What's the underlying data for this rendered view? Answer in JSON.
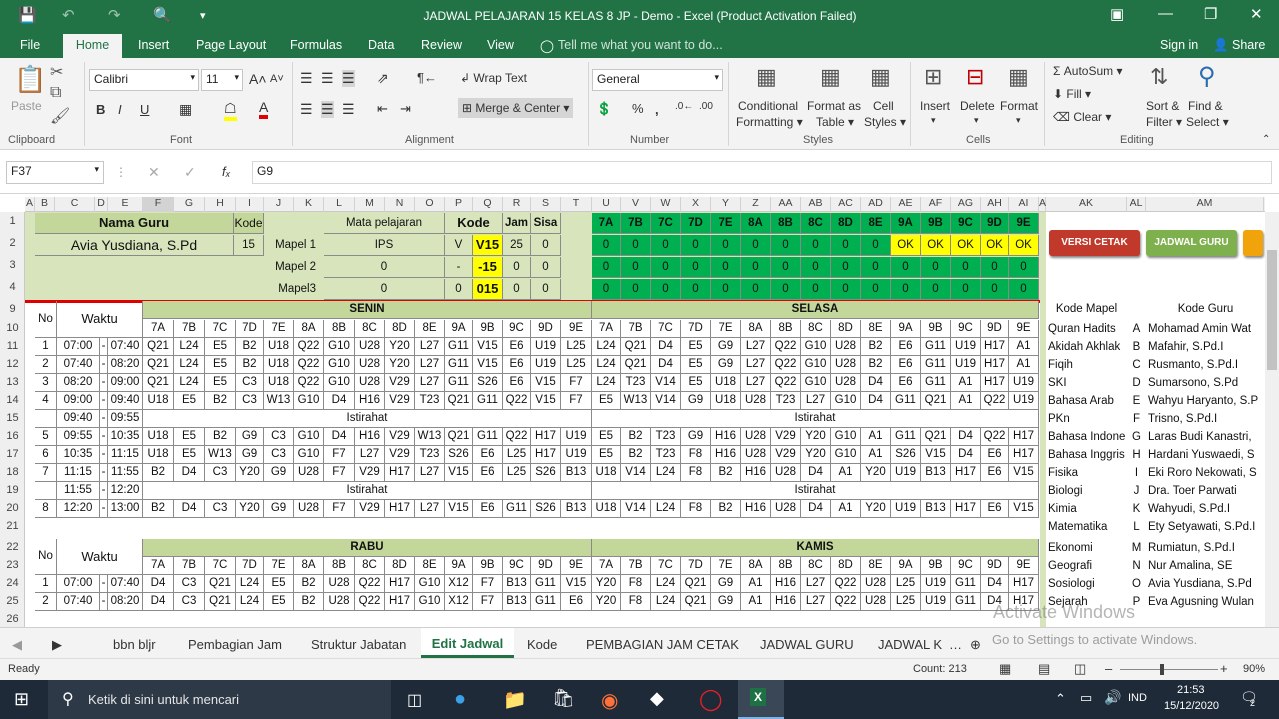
{
  "title": "JADWAL PELAJARAN 15 KELAS 8 JP - Demo - Excel (Product Activation Failed)",
  "ribbon_tabs": [
    "File",
    "Home",
    "Insert",
    "Page Layout",
    "Formulas",
    "Data",
    "Review",
    "View"
  ],
  "tell_me": "Tell me what you want to do...",
  "sign_in": "Sign in",
  "share": "Share",
  "ribbon": {
    "paste": "Paste",
    "clipboard": "Clipboard",
    "font_name": "Calibri",
    "font_size": "11",
    "font": "Font",
    "bold": "B",
    "italic": "I",
    "underline": "U",
    "wrap_text": "Wrap Text",
    "merge_center": "Merge & Center",
    "alignment": "Alignment",
    "number_format": "General",
    "number": "Number",
    "cond1": "Conditional",
    "cond2": "Formatting",
    "fmt1": "Format as",
    "fmt2": "Table",
    "cs1": "Cell",
    "cs2": "Styles",
    "styles": "Styles",
    "insert": "Insert",
    "delete": "Delete",
    "format": "Format",
    "cells": "Cells",
    "autosum": "AutoSum",
    "fill": "Fill",
    "clear": "Clear",
    "sort1": "Sort &",
    "sort2": "Filter",
    "find1": "Find &",
    "find2": "Select",
    "editing": "Editing"
  },
  "name_box": "F37",
  "formula": "G9",
  "cols": [
    "A",
    "B",
    "C",
    "D",
    "E",
    "F",
    "G",
    "H",
    "I",
    "J",
    "K",
    "L",
    "M",
    "N",
    "O",
    "P",
    "Q",
    "R",
    "S",
    "T",
    "U",
    "V",
    "W",
    "X",
    "Y",
    "Z",
    "AA",
    "AB",
    "AC",
    "AD",
    "AE",
    "AF",
    "AG",
    "AH",
    "AI",
    "A",
    "AK",
    "AL",
    "AM"
  ],
  "rows": [
    "1",
    "2",
    "3",
    "4",
    "9",
    "10",
    "11",
    "12",
    "13",
    "14",
    "15",
    "16",
    "17",
    "18",
    "19",
    "20",
    "21",
    "22",
    "23",
    "24",
    "25",
    "26"
  ],
  "top": {
    "nama_guru_label": "Nama Guru",
    "kode_label": "Kode",
    "teacher": "Avia Yusdiana, S.Pd",
    "teacher_code": "15",
    "mapel_label": "Mata pelajaran",
    "kode2": "Kode",
    "jam": "Jam",
    "sisa": "Sisa",
    "m1": "Mapel 1",
    "m2": "Mapel 2",
    "m3": "Mapel3",
    "m1_subj": "IPS",
    "m1_flag": "V",
    "m1_code": "V15",
    "m1_jam": "25",
    "m1_sisa": "0",
    "m2_subj": "0",
    "m2_flag": "-",
    "m2_code": "-15",
    "m2_jam": "0",
    "m2_sisa": "0",
    "m3_subj": "0",
    "m3_flag": "0",
    "m3_code": "015",
    "m3_jam": "0",
    "m3_sisa": "0",
    "classes": [
      "7A",
      "7B",
      "7C",
      "7D",
      "7E",
      "8A",
      "8B",
      "8C",
      "8D",
      "8E",
      "9A",
      "9B",
      "9C",
      "9D",
      "9E"
    ],
    "row2": [
      "0",
      "0",
      "0",
      "0",
      "0",
      "0",
      "0",
      "0",
      "0",
      "0",
      "OK",
      "OK",
      "OK",
      "OK",
      "OK"
    ],
    "row3": [
      "0",
      "0",
      "0",
      "0",
      "0",
      "0",
      "0",
      "0",
      "0",
      "0",
      "0",
      "0",
      "0",
      "0",
      "0"
    ],
    "row4": [
      "0",
      "0",
      "0",
      "0",
      "0",
      "0",
      "0",
      "0",
      "0",
      "0",
      "0",
      "0",
      "0",
      "0",
      "0"
    ]
  },
  "buttons": {
    "versi_cetak": "VERSI CETAK",
    "jadwal_guru": "JADWAL GURU"
  },
  "sched": {
    "no": "No",
    "waktu": "Waktu",
    "day1": "SENIN",
    "day2": "SELASA",
    "day3": "RABU",
    "day4": "KAMIS",
    "istirahat": "Istirahat",
    "rows": [
      {
        "no": "1",
        "t1": "07:00",
        "t2": "07:40",
        "a": [
          "Q21",
          "L24",
          "E5",
          "B2",
          "U18",
          "Q22",
          "G10",
          "U28",
          "Y20",
          "L27",
          "G11",
          "V15",
          "E6",
          "U19",
          "L25"
        ],
        "b": [
          "L24",
          "Q21",
          "D4",
          "E5",
          "G9",
          "L27",
          "Q22",
          "G10",
          "U28",
          "B2",
          "E6",
          "G11",
          "U19",
          "H17",
          "A1"
        ]
      },
      {
        "no": "2",
        "t1": "07:40",
        "t2": "08:20",
        "a": [
          "Q21",
          "L24",
          "E5",
          "B2",
          "U18",
          "Q22",
          "G10",
          "U28",
          "Y20",
          "L27",
          "G11",
          "V15",
          "E6",
          "U19",
          "L25"
        ],
        "b": [
          "L24",
          "Q21",
          "D4",
          "E5",
          "G9",
          "L27",
          "Q22",
          "G10",
          "U28",
          "B2",
          "E6",
          "G11",
          "U19",
          "H17",
          "A1"
        ]
      },
      {
        "no": "3",
        "t1": "08:20",
        "t2": "09:00",
        "a": [
          "Q21",
          "L24",
          "E5",
          "C3",
          "U18",
          "Q22",
          "G10",
          "U28",
          "V29",
          "L27",
          "G11",
          "S26",
          "E6",
          "V15",
          "F7"
        ],
        "b": [
          "L24",
          "T23",
          "V14",
          "E5",
          "U18",
          "L27",
          "Q22",
          "G10",
          "U28",
          "D4",
          "E6",
          "G11",
          "A1",
          "H17",
          "U19"
        ]
      },
      {
        "no": "4",
        "t1": "09:00",
        "t2": "09:40",
        "a": [
          "U18",
          "E5",
          "B2",
          "C3",
          "W13",
          "G10",
          "D4",
          "H16",
          "V29",
          "T23",
          "Q21",
          "G11",
          "Q22",
          "V15",
          "F7"
        ],
        "b": [
          "E5",
          "W13",
          "V14",
          "G9",
          "U18",
          "U28",
          "T23",
          "L27",
          "G10",
          "D4",
          "G11",
          "Q21",
          "A1",
          "Q22",
          "U19"
        ]
      },
      {
        "no": "",
        "t1": "09:40",
        "t2": "09:55",
        "break": true
      },
      {
        "no": "5",
        "t1": "09:55",
        "t2": "10:35",
        "a": [
          "U18",
          "E5",
          "B2",
          "G9",
          "C3",
          "G10",
          "D4",
          "H16",
          "V29",
          "W13",
          "Q21",
          "G11",
          "Q22",
          "H17",
          "U19"
        ],
        "b": [
          "E5",
          "B2",
          "T23",
          "G9",
          "H16",
          "U28",
          "V29",
          "Y20",
          "G10",
          "A1",
          "G11",
          "Q21",
          "D4",
          "Q22",
          "H17"
        ]
      },
      {
        "no": "6",
        "t1": "10:35",
        "t2": "11:15",
        "a": [
          "U18",
          "E5",
          "W13",
          "G9",
          "C3",
          "G10",
          "F7",
          "L27",
          "V29",
          "T23",
          "S26",
          "E6",
          "L25",
          "H17",
          "U19"
        ],
        "b": [
          "E5",
          "B2",
          "T23",
          "F8",
          "H16",
          "U28",
          "V29",
          "Y20",
          "G10",
          "A1",
          "S26",
          "V15",
          "D4",
          "E6",
          "H17"
        ]
      },
      {
        "no": "7",
        "t1": "11:15",
        "t2": "11:55",
        "a": [
          "B2",
          "D4",
          "C3",
          "Y20",
          "G9",
          "U28",
          "F7",
          "V29",
          "H17",
          "L27",
          "V15",
          "E6",
          "L25",
          "S26",
          "B13"
        ],
        "b": [
          "U18",
          "V14",
          "L24",
          "F8",
          "B2",
          "H16",
          "U28",
          "D4",
          "A1",
          "Y20",
          "U19",
          "B13",
          "H17",
          "E6",
          "V15"
        ]
      },
      {
        "no": "",
        "t1": "11:55",
        "t2": "12:20",
        "break": true
      },
      {
        "no": "8",
        "t1": "12:20",
        "t2": "13:00",
        "a": [
          "B2",
          "D4",
          "C3",
          "Y20",
          "G9",
          "U28",
          "F7",
          "V29",
          "H17",
          "L27",
          "V15",
          "E6",
          "G11",
          "S26",
          "B13"
        ],
        "b": [
          "U18",
          "V14",
          "L24",
          "F8",
          "B2",
          "H16",
          "U28",
          "D4",
          "A1",
          "Y20",
          "U19",
          "B13",
          "H17",
          "E6",
          "V15"
        ]
      }
    ],
    "rows2": [
      {
        "no": "1",
        "t1": "07:00",
        "t2": "07:40",
        "a": [
          "D4",
          "C3",
          "Q21",
          "L24",
          "E5",
          "B2",
          "U28",
          "Q22",
          "H17",
          "G10",
          "X12",
          "F7",
          "B13",
          "G11",
          "V15"
        ],
        "b": [
          "Y20",
          "F8",
          "L24",
          "Q21",
          "G9",
          "A1",
          "H16",
          "L27",
          "Q22",
          "U28",
          "L25",
          "U19",
          "G11",
          "D4",
          "H17"
        ]
      },
      {
        "no": "2",
        "t1": "07:40",
        "t2": "08:20",
        "a": [
          "D4",
          "C3",
          "Q21",
          "L24",
          "E5",
          "B2",
          "U28",
          "Q22",
          "H17",
          "G10",
          "X12",
          "F7",
          "B13",
          "G11",
          "E6"
        ],
        "b": [
          "Y20",
          "F8",
          "L24",
          "Q21",
          "G9",
          "A1",
          "H16",
          "L27",
          "Q22",
          "U28",
          "L25",
          "U19",
          "G11",
          "D4",
          "H17"
        ]
      }
    ]
  },
  "side": {
    "kode_mapel": "Kode Mapel",
    "kode_guru": "Kode Guru",
    "items": [
      {
        "m": "Quran Hadits",
        "k": "A",
        "g": "Mohamad Amin Wat"
      },
      {
        "m": "Akidah Akhlak",
        "k": "B",
        "g": "Mafahir, S.Pd.I"
      },
      {
        "m": "Fiqih",
        "k": "C",
        "g": "Rusmanto, S.Pd.I"
      },
      {
        "m": "SKI",
        "k": "D",
        "g": "Sumarsono, S.Pd"
      },
      {
        "m": "Bahasa Arab",
        "k": "E",
        "g": "Wahyu Haryanto, S.P"
      },
      {
        "m": "PKn",
        "k": "F",
        "g": "Trisno, S.Pd.I"
      },
      {
        "m": "Bahasa Indone",
        "k": "G",
        "g": "Laras Budi Kanastri,"
      },
      {
        "m": "Bahasa Inggris",
        "k": "H",
        "g": "Hardani Yuswaedi, S"
      },
      {
        "m": "Fisika",
        "k": "I",
        "g": "Eki Roro Nekowati, S"
      },
      {
        "m": "Biologi",
        "k": "J",
        "g": "Dra. Toer Parwati"
      },
      {
        "m": "Kimia",
        "k": "K",
        "g": "Wahyudi, S.Pd.I"
      },
      {
        "m": "Matematika",
        "k": "L",
        "g": "Ety Setyawati, S.Pd.I"
      },
      {
        "m": "Ekonomi",
        "k": "M",
        "g": "Rumiatun, S.Pd.I"
      },
      {
        "m": "Geografi",
        "k": "N",
        "g": "Nur Amalina, SE"
      },
      {
        "m": "Sosiologi",
        "k": "O",
        "g": "Avia Yusdiana, S.Pd"
      },
      {
        "m": "Sejarah",
        "k": "P",
        "g": "Eva Agusning Wulan"
      }
    ]
  },
  "sheet_tabs": [
    "bbn bljr",
    "Pembagian Jam",
    "Struktur Jabatan",
    "Edit Jadwal",
    "Kode",
    "PEMBAGIAN JAM CETAK",
    "JADWAL GURU",
    "JADWAL K"
  ],
  "status": {
    "ready": "Ready",
    "count": "Count: 213",
    "zoom": "90%"
  },
  "watermark1": "Activate Windows",
  "watermark2": "Go to Settings to activate Windows.",
  "taskbar": {
    "search": "Ketik di sini untuk mencari",
    "lang": "IND",
    "time": "21:53",
    "date": "15/12/2020",
    "notif": "2"
  }
}
